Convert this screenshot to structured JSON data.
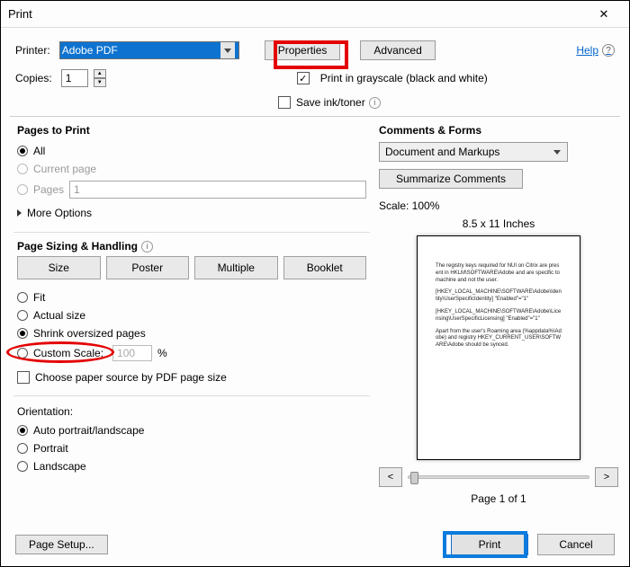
{
  "title": "Print",
  "top": {
    "printer_label": "Printer:",
    "printer_value": "Adobe PDF",
    "properties": "Properties",
    "advanced": "Advanced",
    "help": "Help",
    "copies_label": "Copies:",
    "copies_value": "1",
    "grayscale": "Print in grayscale (black and white)",
    "save_ink": "Save ink/toner"
  },
  "pages": {
    "title": "Pages to Print",
    "all": "All",
    "current": "Current page",
    "pages_label": "Pages",
    "pages_value": "1",
    "more": "More Options"
  },
  "sizing": {
    "title": "Page Sizing & Handling",
    "tabs": {
      "size": "Size",
      "poster": "Poster",
      "multiple": "Multiple",
      "booklet": "Booklet"
    },
    "fit": "Fit",
    "actual": "Actual size",
    "shrink": "Shrink oversized pages",
    "custom": "Custom Scale:",
    "custom_value": "100",
    "custom_pct": "%",
    "choose_src": "Choose paper source by PDF page size"
  },
  "orientation": {
    "title": "Orientation:",
    "auto": "Auto portrait/landscape",
    "portrait": "Portrait",
    "landscape": "Landscape"
  },
  "right": {
    "cf_title": "Comments & Forms",
    "cf_value": "Document and Markups",
    "summarize": "Summarize Comments",
    "scale": "Scale: 100%",
    "paper": "8.5 x 11 Inches",
    "preview_lines": [
      "The registry keys required for NUI on Citrix are present in HKLM\\SOFTWARE\\Adobe and are specific to machine and not the user.",
      "[HKEY_LOCAL_MACHINE\\SOFTWARE\\Adobe\\Identity\\UserSpecificIdentity] \"Enabled\"=\"1\"",
      "[HKEY_LOCAL_MACHINE\\SOFTWARE\\Adobe\\Licensing\\UserSpecificLicensing] \"Enabled\"=\"1\"",
      "Apart from the user's Roaming area (%appdata%\\Adobe) and registry HKEY_CURRENT_USER\\SOFTWARE\\Adobe should be synced."
    ],
    "page_of": "Page 1 of 1"
  },
  "footer": {
    "page_setup": "Page Setup...",
    "print": "Print",
    "cancel": "Cancel"
  }
}
